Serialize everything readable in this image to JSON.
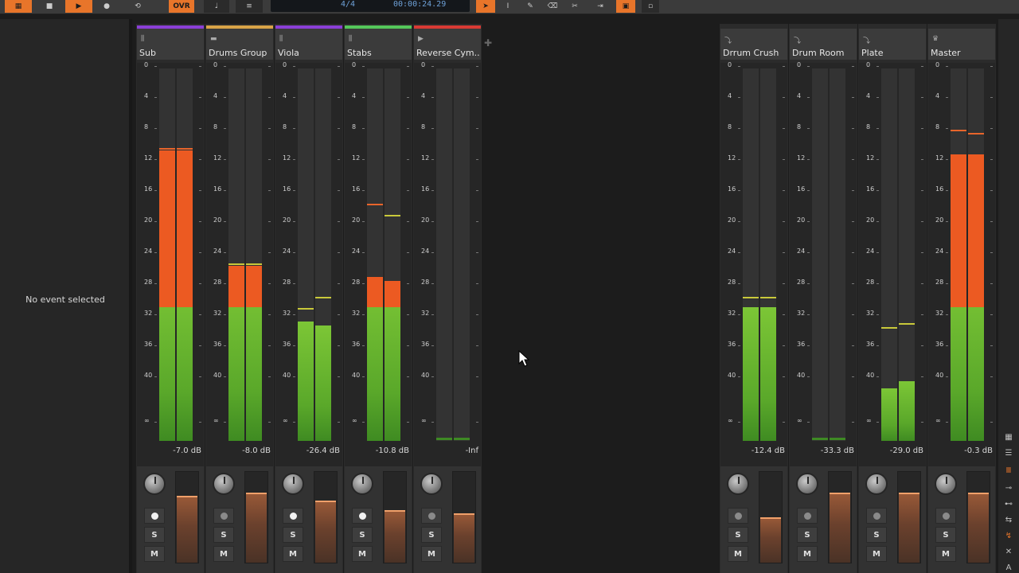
{
  "toolbar": {
    "ovr_label": "OVR",
    "time_signature": "4/4",
    "time_position": "00:00:24.29"
  },
  "inspector": {
    "empty_text": "No event selected"
  },
  "meter_scale": [
    "0",
    "4",
    "8",
    "12",
    "16",
    "20",
    "24",
    "28",
    "32",
    "36",
    "40",
    "∞"
  ],
  "strip_buttons": {
    "solo": "S",
    "mute": "M"
  },
  "tracks": [
    {
      "name": "Sub",
      "color": "#8a3fd6",
      "icon": "instrument-track-icon",
      "db": "-7.0 dB",
      "meter": [
        0.78,
        0.78
      ],
      "peak": [
        0.78,
        0.78
      ],
      "rec_armed": true,
      "fader": 0.74
    },
    {
      "name": "Drums Group",
      "color": "#d8a347",
      "icon": "group-track-icon",
      "db": "-8.0 dB",
      "meter": [
        0.47,
        0.47
      ],
      "peak": [
        0.47,
        0.47
      ],
      "rec_armed": false,
      "fader": 0.77
    },
    {
      "name": "Viola",
      "color": "#8a3fd6",
      "icon": "instrument-track-icon",
      "db": "-26.4 dB",
      "meter": [
        0.32,
        0.31
      ],
      "peak": [
        0.35,
        0.38
      ],
      "rec_armed": true,
      "fader": 0.68
    },
    {
      "name": "Stabs",
      "color": "#55c75a",
      "icon": "instrument-track-icon",
      "db": "-10.8 dB",
      "meter": [
        0.44,
        0.43
      ],
      "peak": [
        0.63,
        0.6
      ],
      "rec_armed": true,
      "fader": 0.58
    },
    {
      "name": "Reverse Cym...",
      "color": "#d83a34",
      "icon": "audio-track-icon",
      "db": "-Inf",
      "meter": [
        0.0,
        0.0
      ],
      "peak": [
        0.0,
        0.0
      ],
      "rec_armed": false,
      "fader": 0.54
    }
  ],
  "fx_tracks": [
    {
      "name": "Drrum Crush",
      "icon": "effect-track-icon",
      "db": "-12.4 dB",
      "meter": [
        0.36,
        0.36
      ],
      "peak": [
        0.38,
        0.38
      ],
      "fader": 0.5
    },
    {
      "name": "Drum Room",
      "icon": "effect-track-icon",
      "db": "-33.3 dB",
      "meter": [
        0.0,
        0.0
      ],
      "peak": [
        0.0,
        0.0
      ],
      "fader": 0.77
    },
    {
      "name": "Plate",
      "icon": "effect-track-icon",
      "db": "-29.0 dB",
      "meter": [
        0.14,
        0.16
      ],
      "peak": [
        0.3,
        0.31
      ],
      "fader": 0.77
    },
    {
      "name": "Master",
      "icon": "master-track-icon",
      "db": "-0.3 dB",
      "meter": [
        0.77,
        0.77
      ],
      "peak": [
        0.83,
        0.82
      ],
      "fader": 0.77
    }
  ]
}
